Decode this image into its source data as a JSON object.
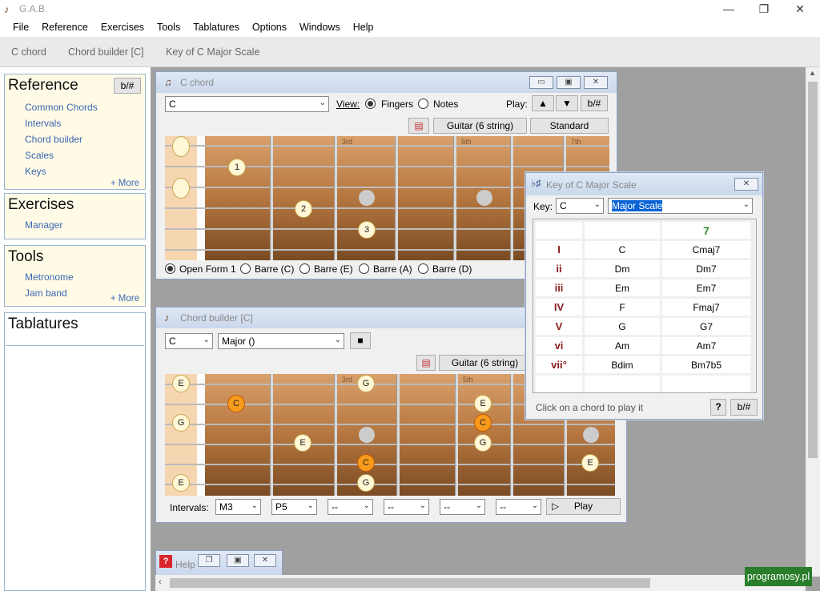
{
  "app": {
    "title": "G.A.B."
  },
  "menu": [
    "File",
    "Reference",
    "Exercises",
    "Tools",
    "Tablatures",
    "Options",
    "Windows",
    "Help"
  ],
  "tabs": [
    "C chord",
    "Chord builder [C]",
    "Key of C Major Scale"
  ],
  "sidebar": {
    "reference": {
      "title": "Reference",
      "toggle": "b/#",
      "links": [
        "Common Chords",
        "Intervals",
        "Chord builder",
        "Scales",
        "Keys"
      ],
      "more": "+ More"
    },
    "exercises": {
      "title": "Exercises",
      "links": [
        "Manager"
      ]
    },
    "tools": {
      "title": "Tools",
      "links": [
        "Metronome",
        "Jam band"
      ],
      "more": "+ More"
    },
    "tablatures": {
      "title": "Tablatures"
    }
  },
  "chord_window": {
    "title": "C chord",
    "chord_value": "C",
    "view_label": "View:",
    "fingers_label": "Fingers",
    "notes_label": "Notes",
    "play_label": "Play:",
    "accidental": "b/#",
    "instrument": "Guitar (6 string)",
    "tuning": "Standard",
    "fret_labels": [
      "3rd",
      "5th",
      "7th"
    ],
    "fingers": [
      "1",
      "2",
      "3"
    ],
    "forms": [
      "Open Form 1",
      "Barre (C)",
      "Barre (E)",
      "Barre (A)",
      "Barre (D)"
    ]
  },
  "builder_window": {
    "title": "Chord builder [C]",
    "root": "C",
    "type": "Major ()",
    "instrument": "Guitar (6 string)",
    "fret_labels": [
      "3rd",
      "5th"
    ],
    "open_notes": [
      "E",
      "G",
      "E"
    ],
    "notes": [
      "G",
      "C",
      "E",
      "E",
      "C",
      "G",
      "C",
      "G",
      "E"
    ],
    "intervals_label": "Intervals:",
    "intervals": [
      "M3",
      "P5",
      "--",
      "--",
      "--",
      "--"
    ],
    "play": "Play"
  },
  "scale_window": {
    "title": "Key of C Major Scale",
    "key_label": "Key:",
    "key_value": "C",
    "scale_value": "Major Scale",
    "header_7": "7",
    "rows": [
      {
        "degree": "I",
        "triad": "C",
        "seventh": "Cmaj7"
      },
      {
        "degree": "ii",
        "triad": "Dm",
        "seventh": "Dm7"
      },
      {
        "degree": "iii",
        "triad": "Em",
        "seventh": "Em7"
      },
      {
        "degree": "IV",
        "triad": "F",
        "seventh": "Fmaj7"
      },
      {
        "degree": "V",
        "triad": "G",
        "seventh": "G7"
      },
      {
        "degree": "vi",
        "triad": "Am",
        "seventh": "Am7"
      },
      {
        "degree": "vii°",
        "triad": "Bdim",
        "seventh": "Bm7b5"
      }
    ],
    "hint": "Click on a chord to play it",
    "help": "?",
    "accidental": "b/#"
  },
  "help_window": {
    "title": "Help"
  },
  "watermark": "programosy.pl",
  "colors": {
    "root_note": "#f89a1c",
    "degree": "#8b1a1a",
    "header_7": "#2e8b2e",
    "link": "#3b66b4"
  }
}
